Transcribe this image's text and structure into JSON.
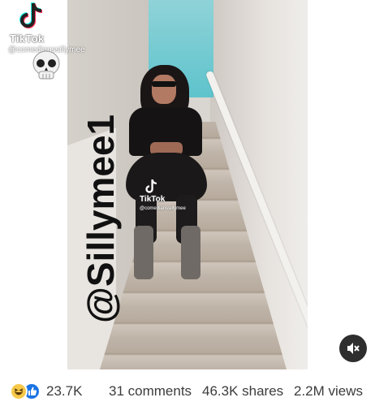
{
  "video": {
    "tiktok_top": {
      "brand": "TikTok",
      "handle": "@comedianssillymee"
    },
    "watermark": "@Sillymee1",
    "tiktok_mid": {
      "brand": "TikTok",
      "handle": "@comedianssillymee"
    },
    "mute_icon": "speaker-muted-icon"
  },
  "stats": {
    "reactions_count": "23.7K",
    "comments": "31 comments",
    "shares": "46.3K shares",
    "views": "2.2M views",
    "reaction_icons": [
      "haha-icon",
      "like-icon"
    ]
  },
  "colors": {
    "like_blue": "#1b74e4",
    "haha_yellow": "#f7c94a",
    "text_gray": "#3c3c3c",
    "mute_bg": "#2e2e2e"
  }
}
